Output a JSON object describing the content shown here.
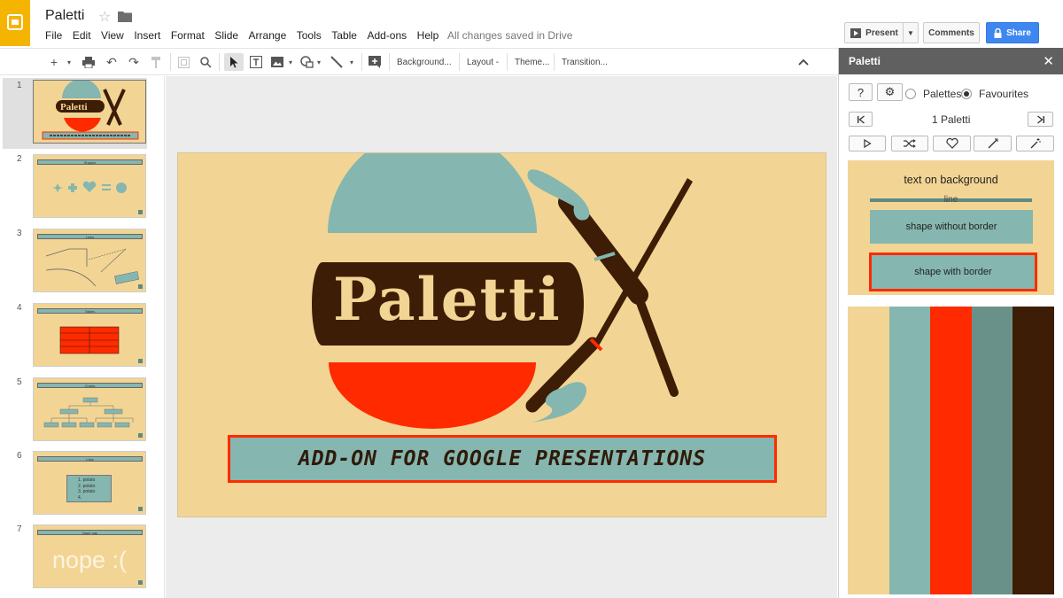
{
  "app": {
    "title": "Paletti",
    "save_status": "All changes saved in Drive"
  },
  "menu": [
    "File",
    "Edit",
    "View",
    "Insert",
    "Format",
    "Slide",
    "Arrange",
    "Tools",
    "Table",
    "Add-ons",
    "Help"
  ],
  "header_buttons": {
    "present": "Present",
    "comments": "Comments",
    "share": "Share"
  },
  "toolbar": {
    "background": "Background...",
    "layout": "Layout -",
    "theme": "Theme...",
    "transition": "Transition..."
  },
  "slides": [
    {
      "num": "1",
      "title": ""
    },
    {
      "num": "2",
      "title": "Shapes"
    },
    {
      "num": "3",
      "title": "Lines"
    },
    {
      "num": "4",
      "title": "Tables"
    },
    {
      "num": "5",
      "title": "Charts"
    },
    {
      "num": "6",
      "title": "Lists"
    },
    {
      "num": "7",
      "title": "Nope nay",
      "body": "nope :("
    }
  ],
  "slide_list_items": [
    "potato",
    "potato",
    "potato"
  ],
  "main_slide": {
    "logo_word": "Paletti",
    "subtitle": "ADD-ON FOR GOOGLE PRESENTATIONS"
  },
  "sidebar": {
    "title": "Paletti",
    "radio_palettes": "Palettes",
    "radio_favourites": "Favourites",
    "selected_radio": "Favourites",
    "palette_counter": "1  Paletti",
    "preview": {
      "text": "text on background",
      "line": "line",
      "shape_noborder": "shape without border",
      "shape_border": "shape with border"
    },
    "palette_colors": [
      "#f2d594",
      "#85b6b0",
      "#ff2a00",
      "#6a9189",
      "#3d1d06"
    ]
  },
  "colors": {
    "accent_yellow": "#f4b400",
    "share_blue": "#3e87f0",
    "slide_bg": "#f2d594",
    "teal": "#85b6b0",
    "red": "#ff2a00",
    "brown": "#3d1d06"
  }
}
